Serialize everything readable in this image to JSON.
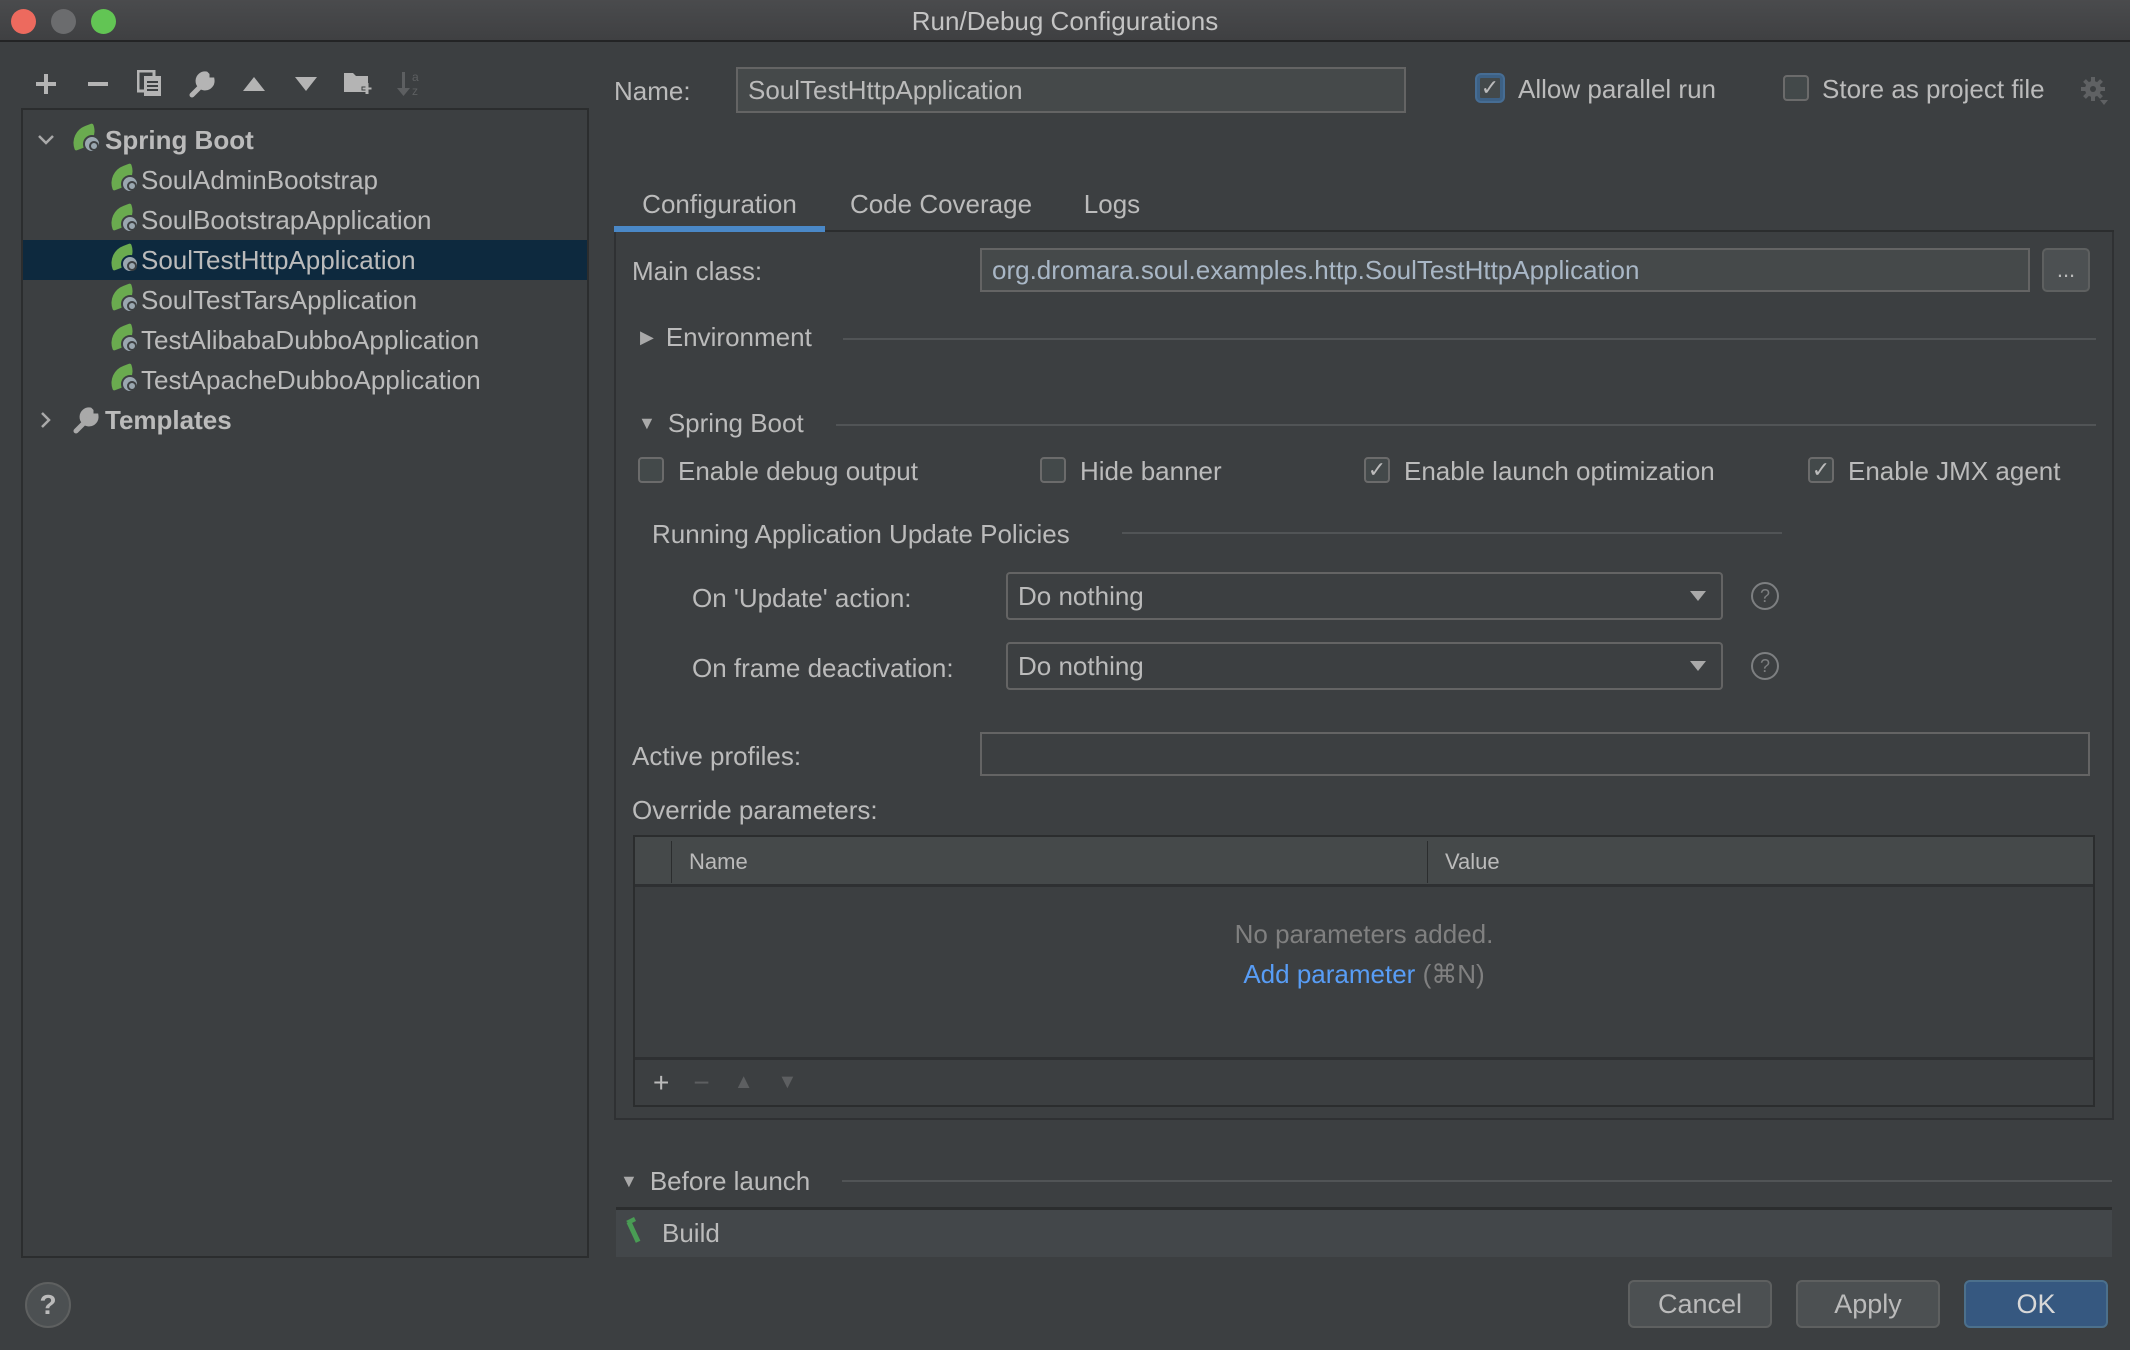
{
  "window": {
    "title": "Run/Debug Configurations"
  },
  "toolbar": {
    "add": "+",
    "remove": "−",
    "copy": "⧉",
    "edit_defaults": "🔧",
    "move_up": "▲",
    "move_down": "▼",
    "new_folder": "📁",
    "sort": "↓ᵃᶻ"
  },
  "tree": {
    "groups": [
      {
        "label": "Spring Boot",
        "expanded": true,
        "items": [
          {
            "label": "SoulAdminBootstrap",
            "selected": false
          },
          {
            "label": "SoulBootstrapApplication",
            "selected": false
          },
          {
            "label": "SoulTestHttpApplication",
            "selected": true
          },
          {
            "label": "SoulTestTarsApplication",
            "selected": false
          },
          {
            "label": "TestAlibabaDubboApplication",
            "selected": false
          },
          {
            "label": "TestApacheDubboApplication",
            "selected": false
          }
        ]
      },
      {
        "label": "Templates",
        "expanded": false
      }
    ]
  },
  "header": {
    "name_label": "Name:",
    "name_value": "SoulTestHttpApplication",
    "allow_parallel_label": "Allow parallel run",
    "allow_parallel_checked": true,
    "store_project_label": "Store as project file",
    "store_project_checked": false
  },
  "tabs": [
    {
      "label": "Configuration",
      "active": true
    },
    {
      "label": "Code Coverage",
      "active": false
    },
    {
      "label": "Logs",
      "active": false
    }
  ],
  "config": {
    "main_class_label": "Main class:",
    "main_class_value": "org.dromara.soul.examples.http.SoulTestHttpApplication",
    "browse_label": "...",
    "environment_label": "Environment",
    "spring_boot_label": "Spring Boot",
    "options": [
      {
        "label": "Enable debug output",
        "checked": false
      },
      {
        "label": "Hide banner",
        "checked": false
      },
      {
        "label": "Enable launch optimization",
        "checked": true
      },
      {
        "label": "Enable JMX agent",
        "checked": true
      }
    ],
    "policies_title": "Running Application Update Policies",
    "update_action_label": "On 'Update' action:",
    "update_action_value": "Do nothing",
    "frame_deactivation_label": "On frame deactivation:",
    "frame_deactivation_value": "Do nothing",
    "help_glyph": "?",
    "active_profiles_label": "Active profiles:",
    "active_profiles_value": "",
    "override_label": "Override parameters:",
    "params_columns": [
      "Name",
      "Value"
    ],
    "params_empty": "No parameters added.",
    "params_add_link": "Add parameter",
    "params_add_shortcut": "(⌘N)",
    "params_toolbar": {
      "add": "+",
      "remove": "−",
      "up": "▲",
      "down": "▼"
    }
  },
  "before_launch": {
    "label": "Before launch",
    "tasks": [
      "Build"
    ]
  },
  "footer": {
    "help": "?",
    "cancel": "Cancel",
    "apply": "Apply",
    "ok": "OK"
  },
  "colors": {
    "accent": "#4a88c7",
    "selection": "#0d293e",
    "link": "#589df6",
    "default_button": "#365880",
    "spring_green": "#6aab4f"
  }
}
